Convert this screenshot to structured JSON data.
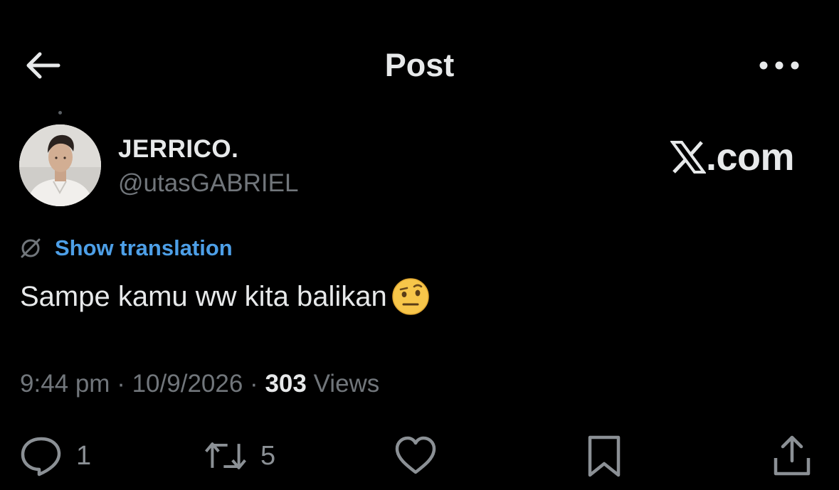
{
  "header": {
    "title": "Post",
    "back_icon": "arrow-left-icon",
    "more_icon": "more-horizontal-icon"
  },
  "author": {
    "display_name": "JERRICO.",
    "handle": "@utasGABRIEL"
  },
  "watermark": {
    "text": ".com",
    "logo_icon": "x-logo-icon"
  },
  "translation": {
    "icon": "translate-globe-icon",
    "label": "Show translation"
  },
  "post": {
    "text": "Sampe kamu ww kita balikan",
    "emoji": "face-with-raised-eyebrow"
  },
  "meta": {
    "time": "9:44 pm",
    "separator": "·",
    "date": "10/9/2026",
    "views_count": "303",
    "views_label": "Views"
  },
  "actions": {
    "reply_count": "1",
    "repost_count": "5"
  },
  "colors": {
    "background": "#000000",
    "primary_text": "#e7e9ea",
    "secondary_text": "#71767b",
    "link": "#4d9fe7"
  }
}
